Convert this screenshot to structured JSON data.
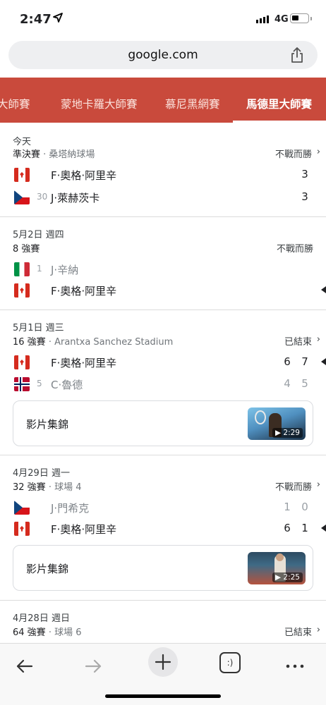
{
  "status_bar": {
    "time": "2:47",
    "network": "4G"
  },
  "browser": {
    "url": "google.com"
  },
  "tabs": [
    {
      "label": "大師賽"
    },
    {
      "label": "蒙地卡羅大師賽"
    },
    {
      "label": "慕尼黑網賽"
    },
    {
      "label": "馬德里大師賽",
      "active": true
    }
  ],
  "matches": [
    {
      "date": "今天",
      "round": "準決賽",
      "venue": "桑塔納球場",
      "status": "不戰而勝",
      "players": [
        {
          "flag": "canada",
          "seed": "",
          "name": "F·奧格·阿里辛",
          "scores": [
            "3"
          ],
          "winner": false
        },
        {
          "flag": "czechia",
          "seed": "30",
          "name": "J·萊赫茨卡",
          "scores": [
            "3"
          ],
          "winner": false
        }
      ]
    },
    {
      "date": "5月2日 週四",
      "round": "8 強賽",
      "venue": "",
      "status": "不戰而勝",
      "players": [
        {
          "flag": "italy",
          "seed": "1",
          "name": "J·辛納",
          "scores": [],
          "winner": false
        },
        {
          "flag": "canada",
          "seed": "",
          "name": "F·奧格·阿里辛",
          "scores": [],
          "winner": true
        }
      ]
    },
    {
      "date": "5月1日 週三",
      "round": "16 強賽",
      "venue": "Arantxa Sanchez Stadium",
      "status": "已結束",
      "players": [
        {
          "flag": "canada",
          "seed": "",
          "name": "F·奧格·阿里辛",
          "scores": [
            "6",
            "7"
          ],
          "winner": true
        },
        {
          "flag": "norway",
          "seed": "5",
          "name": "C·魯德",
          "scores": [
            "4",
            "5"
          ],
          "winner": false
        }
      ],
      "highlights": {
        "label": "影片集錦",
        "duration": "2:29"
      }
    },
    {
      "date": "4月29日 週一",
      "round": "32 強賽",
      "venue": "球場 4",
      "status": "不戰而勝",
      "players": [
        {
          "flag": "czechia",
          "seed": "",
          "name": "J·門希克",
          "scores": [
            "1",
            "0"
          ],
          "winner": false
        },
        {
          "flag": "canada",
          "seed": "",
          "name": "F·奧格·阿里辛",
          "scores": [
            "6",
            "1"
          ],
          "winner": true
        }
      ],
      "highlights": {
        "label": "影片集錦",
        "duration": "2:25"
      }
    },
    {
      "date": "4月28日 週日",
      "round": "64 強賽",
      "venue": "球場 6",
      "status": "已結束",
      "players": []
    }
  ],
  "toolbar": {
    "tabs_glyph": ":)"
  },
  "icons": [
    "location-arrow-icon",
    "signal-icon",
    "battery-icon",
    "share-icon",
    "chevron-right-icon",
    "back-icon",
    "forward-icon",
    "plus-icon",
    "tabs-icon",
    "more-icon"
  ]
}
